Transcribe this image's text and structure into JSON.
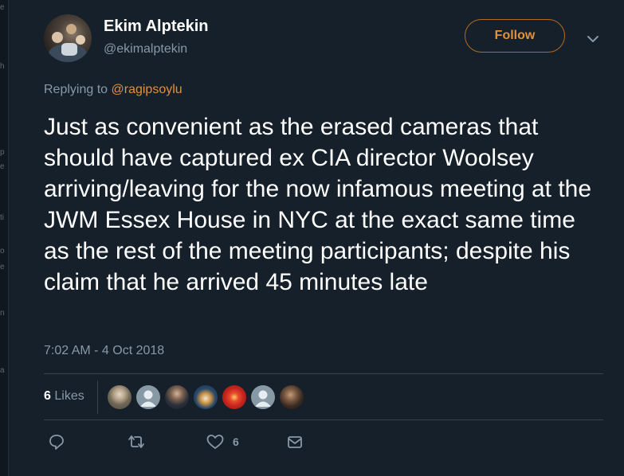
{
  "user": {
    "name": "Ekim Alptekin",
    "handle": "@ekimalptekin"
  },
  "follow_label": "Follow",
  "reply_to": {
    "prefix": "Replying to",
    "mention": "@ragipsoylu"
  },
  "tweet_text": "Just as convenient as the erased cameras that should have captured ex CIA director Woolsey arriving/leaving for the now infamous meeting at the JWM Essex House in NYC at the exact same time as the rest of the meeting participants; despite his claim that he arrived 45 minutes late",
  "timestamp": "7:02 AM - 4 Oct 2018",
  "likes": {
    "count": "6",
    "label": "Likes",
    "likers": [
      "photo",
      "default",
      "default",
      "photo",
      "red",
      "default",
      "photo"
    ]
  },
  "actions": {
    "like_count": "6"
  },
  "colors": {
    "background": "#15202b",
    "accent": "#e0913a",
    "secondary_text": "#8899a6",
    "divider": "#38444d"
  },
  "icons": [
    "chevron-down-icon",
    "reply-icon",
    "retweet-icon",
    "heart-icon",
    "message-icon"
  ]
}
